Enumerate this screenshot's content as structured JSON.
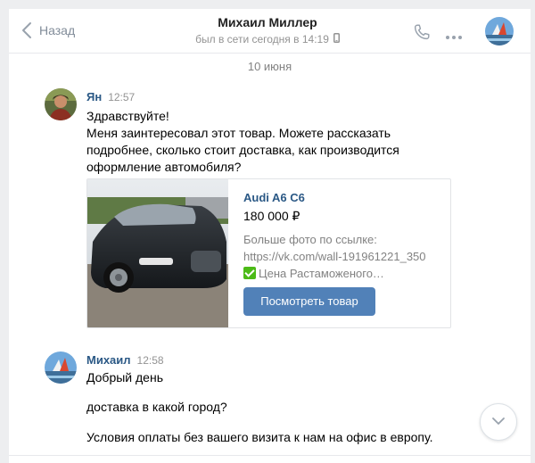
{
  "header": {
    "back_label": "Назад",
    "peer_name": "Михаил Миллер",
    "peer_status": "был в сети сегодня в 14:19"
  },
  "date_separator": "10 июня",
  "messages": [
    {
      "author": "Ян",
      "time": "12:57",
      "lines": [
        "Здравствуйте!",
        "Меня заинтересовал этот товар. Можете рассказать",
        "подробнее, сколько стоит доставка, как производится",
        "оформление автомобиля?"
      ],
      "product": {
        "title": "Audi A6 C6",
        "price": "180 000 ₽",
        "desc_line1": "Больше фото по ссылке:",
        "desc_line2": "https://vk.com/wall-191961221_350",
        "desc_line3": "Цена Растаможеного…",
        "button_label": "Посмотреть товар"
      }
    },
    {
      "author": "Михаил",
      "time": "12:58",
      "lines": [
        "Добрый день",
        "доставка в какой город?",
        "Условия оплаты без вашего визита к нам на офис в европу."
      ]
    }
  ],
  "icons": {
    "back": "chevron-left-icon",
    "phone": "phone-icon",
    "more": "more-dots-icon",
    "mobile": "mobile-phone-icon",
    "scroll": "chevron-down-icon"
  },
  "colors": {
    "accent": "#5181b8",
    "link": "#2a5885",
    "muted": "#939393",
    "check": "#4cbb17"
  }
}
